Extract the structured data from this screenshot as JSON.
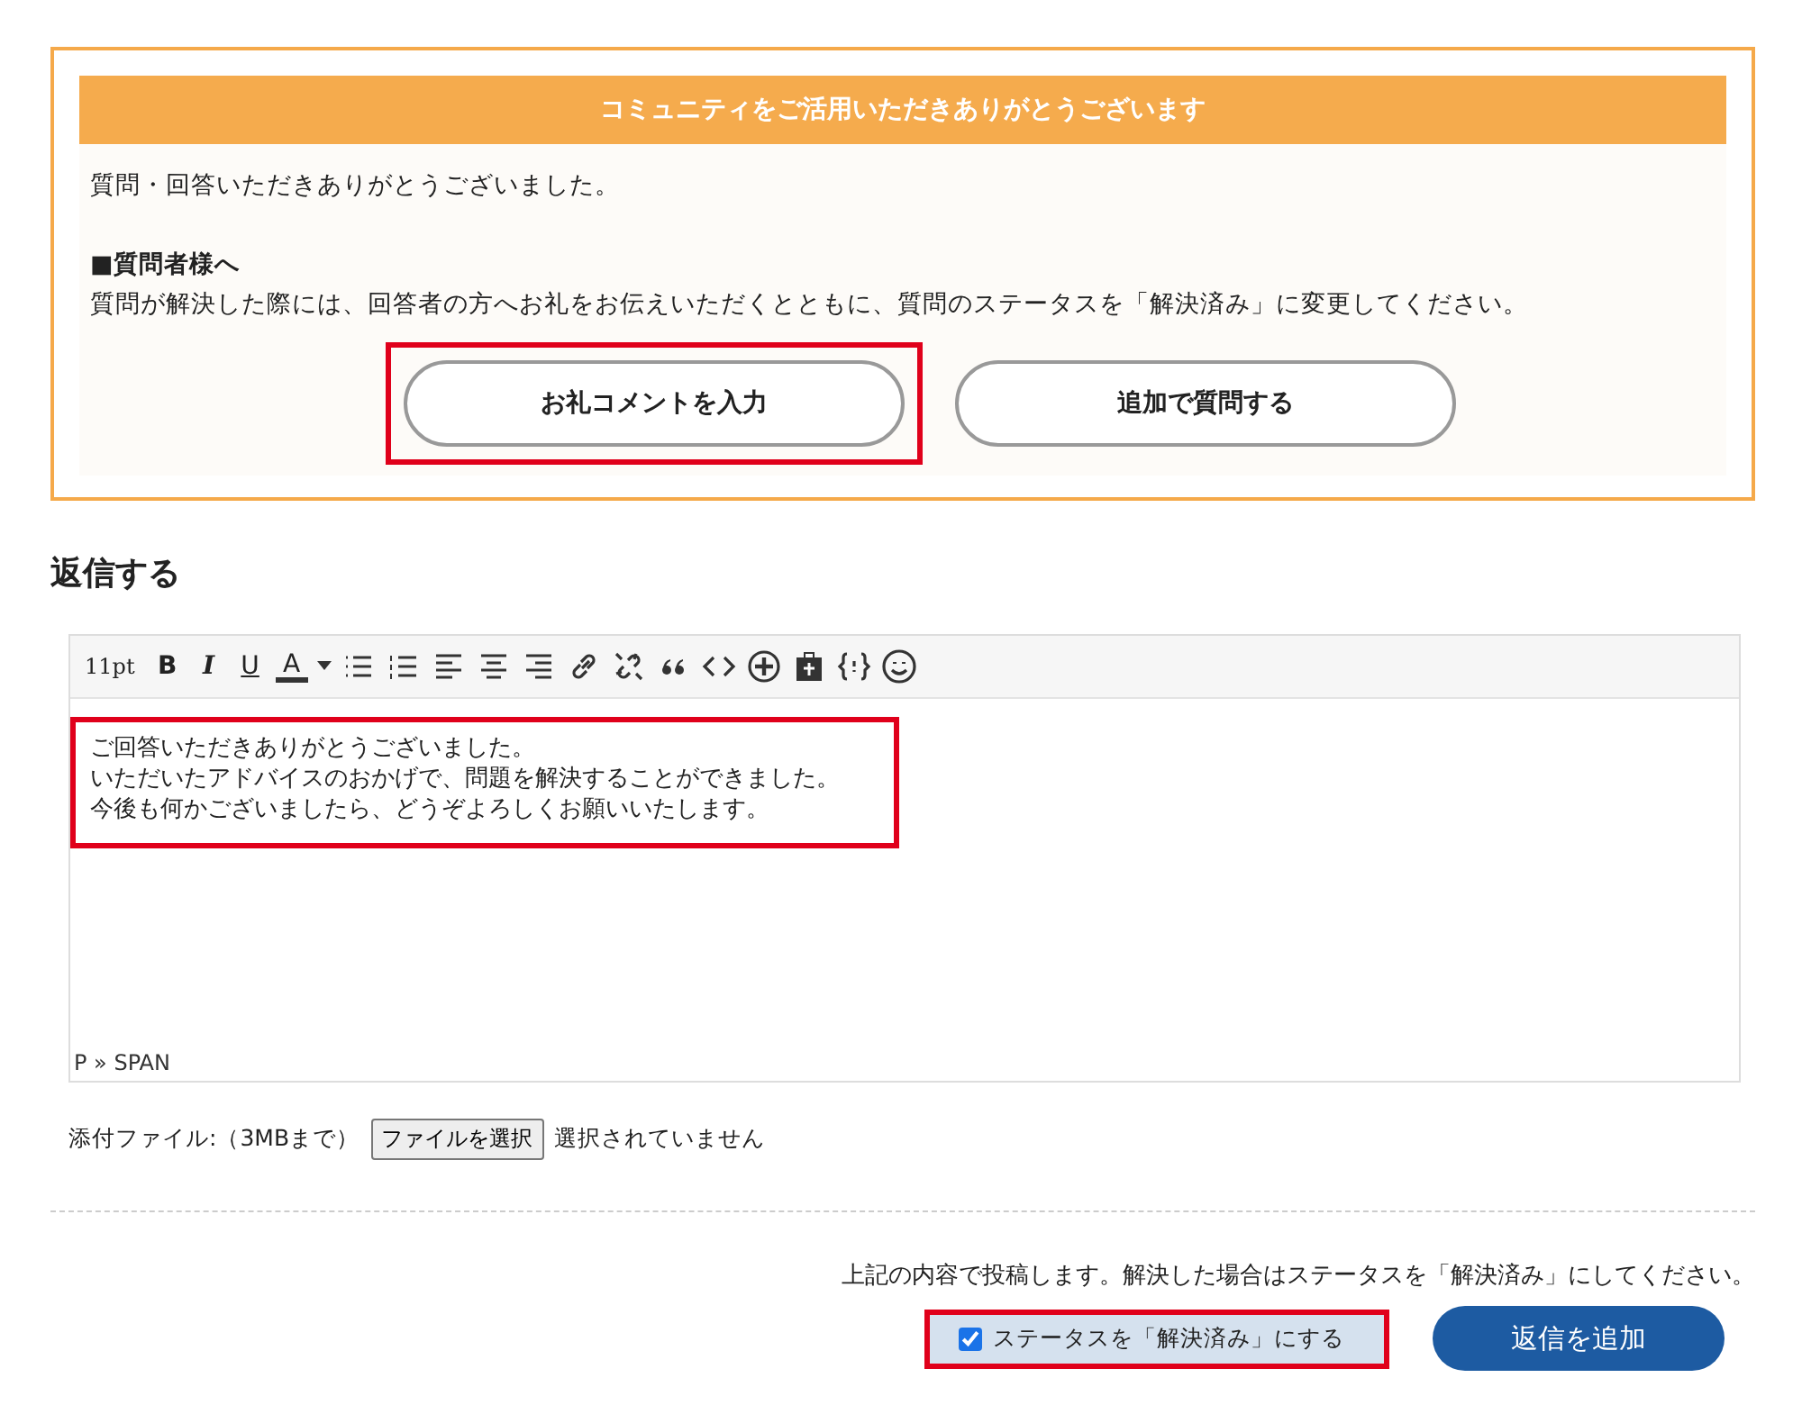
{
  "notice": {
    "title": "コミュニティをご活用いただきありがとうございます",
    "message": "質問・回答いただきありがとうございました。",
    "heading": "■質問者様へ",
    "instruction": "質問が解決した際には、回答者の方へお礼をお伝えいただくとともに、質問のステータスを「解決済み」に変更してください。",
    "buttons": [
      {
        "label": "お礼コメントを入力",
        "highlighted": true
      },
      {
        "label": "追加で質問する",
        "highlighted": false
      }
    ]
  },
  "reply": {
    "heading": "返信する",
    "toolbar": {
      "font_size": "11pt",
      "format_buttons": [
        "B",
        "I",
        "U",
        "A"
      ]
    },
    "lines": [
      "ご回答いただきありがとうございました。",
      "いただいたアドバイスのおかげで、問題を解決することができました。",
      "今後も何かございましたら、どうぞよろしくお願いいたします。"
    ],
    "content_highlighted": true,
    "path": "P » SPAN",
    "attachment": {
      "label": "添付ファイル:（3MBまで）",
      "button": "ファイルを選択",
      "status": "選択されていません"
    },
    "note": "上記の内容で投稿します。解決した場合はステータスを「解決済み」にしてください。",
    "resolve": {
      "label": "ステータスを「解決済み」にする",
      "checked": true,
      "highlighted": true
    },
    "submit": "返信を追加"
  }
}
